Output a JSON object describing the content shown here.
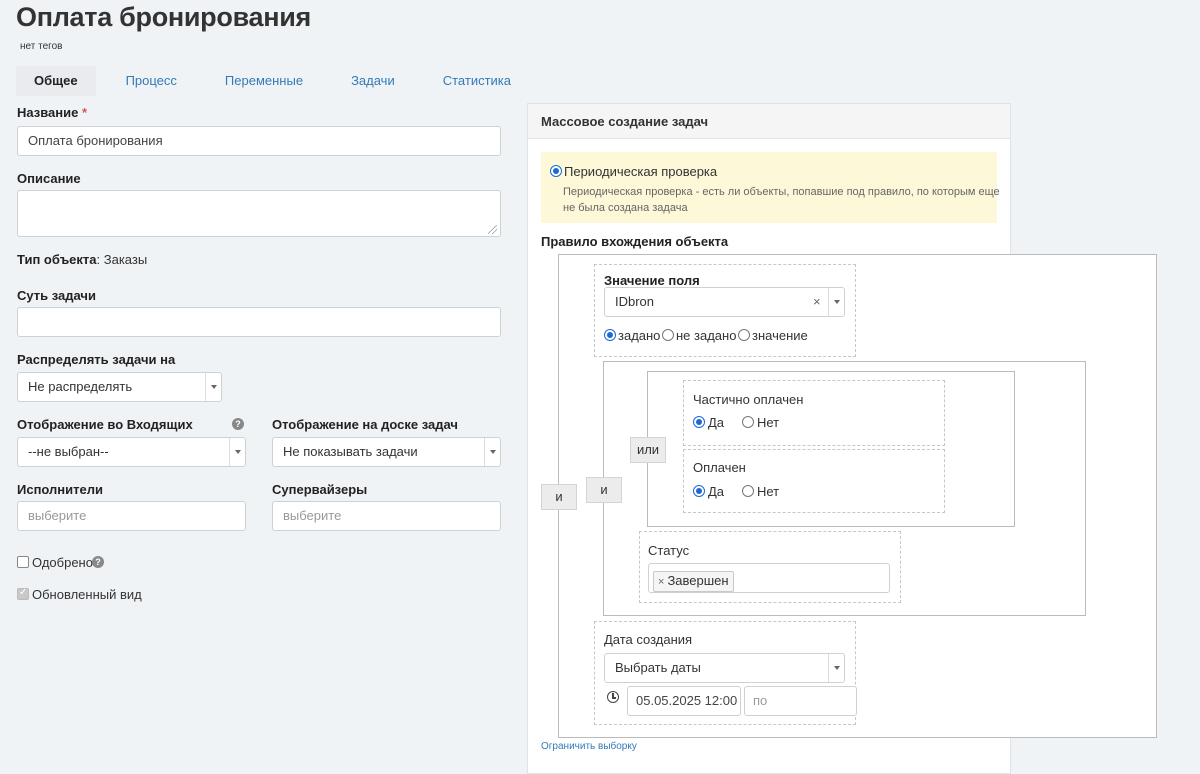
{
  "page": {
    "title": "Оплата бронирования",
    "tags": "нет тегов"
  },
  "tabs": [
    {
      "label": "Общее",
      "active": true
    },
    {
      "label": "Процесс"
    },
    {
      "label": "Переменные"
    },
    {
      "label": "Задачи"
    },
    {
      "label": "Статистика"
    }
  ],
  "form": {
    "name_label": "Название",
    "required_mark": "*",
    "name_value": "Оплата бронирования",
    "description_label": "Описание",
    "description_value": "",
    "object_type_label": "Тип объекта",
    "object_type_value": ": Заказы",
    "essence_label": "Суть задачи",
    "essence_value": "",
    "distribute_label": "Распределять задачи на",
    "distribute_value": "Не распределять",
    "inbox_label": "Отображение во Входящих",
    "inbox_value": "--не выбран--",
    "board_label": "Отображение на доске задач",
    "board_value": "Не показывать задачи",
    "executors_label": "Исполнители",
    "executors_placeholder": "выберите",
    "supervisors_label": "Супервайзеры",
    "supervisors_placeholder": "выберите",
    "approved_label": "Одобрено",
    "approved_checked": false,
    "updated_view_label": "Обновленный вид",
    "updated_view_checked": true,
    "help_glyph": "?"
  },
  "mass": {
    "header": "Массовое создание задач",
    "periodic_label": "Периодическая проверка",
    "periodic_desc_line1": "Периодическая проверка - есть ли объекты, попавшие под правило, по которым еще",
    "periodic_desc_line2": "не была создана задача",
    "rule_label": "Правило вхождения объекта",
    "outer_and": "и",
    "field_value_label": "Значение поля",
    "field_value": "IDbron",
    "clear_glyph": "×",
    "opt_set": "задано",
    "opt_not_set": "не задано",
    "opt_value": "значение",
    "inner_and": "и",
    "or_label": "или",
    "partially_paid_label": "Частично оплачен",
    "paid_label": "Оплачен",
    "yes": "Да",
    "no": "Нет",
    "status_label": "Статус",
    "status_chip": "Завершен",
    "chip_remove": "×",
    "created_label": "Дата создания",
    "created_select": "Выбрать даты",
    "date_from": "05.05.2025 12:00",
    "date_to_placeholder": "по",
    "limit_link": "Ограничить выборку"
  }
}
